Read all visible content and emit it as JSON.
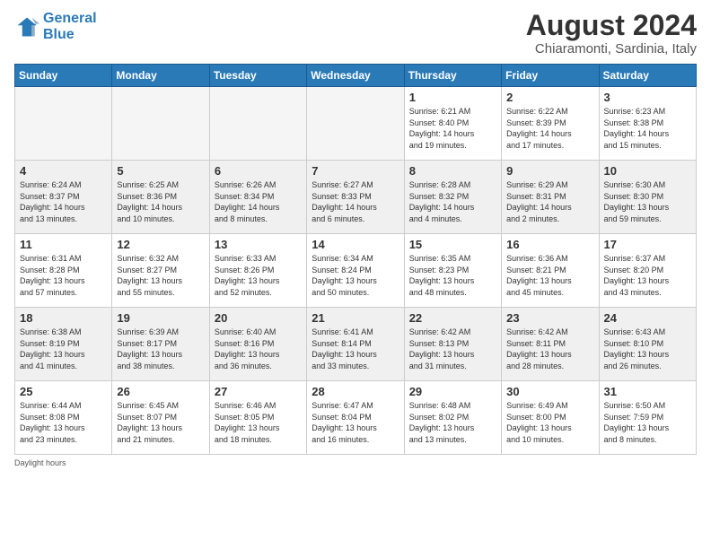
{
  "header": {
    "logo_line1": "General",
    "logo_line2": "Blue",
    "month": "August 2024",
    "location": "Chiaramonti, Sardinia, Italy"
  },
  "weekdays": [
    "Sunday",
    "Monday",
    "Tuesday",
    "Wednesday",
    "Thursday",
    "Friday",
    "Saturday"
  ],
  "weeks": [
    {
      "shaded": false,
      "days": [
        {
          "num": "",
          "info": ""
        },
        {
          "num": "",
          "info": ""
        },
        {
          "num": "",
          "info": ""
        },
        {
          "num": "",
          "info": ""
        },
        {
          "num": "1",
          "info": "Sunrise: 6:21 AM\nSunset: 8:40 PM\nDaylight: 14 hours\nand 19 minutes."
        },
        {
          "num": "2",
          "info": "Sunrise: 6:22 AM\nSunset: 8:39 PM\nDaylight: 14 hours\nand 17 minutes."
        },
        {
          "num": "3",
          "info": "Sunrise: 6:23 AM\nSunset: 8:38 PM\nDaylight: 14 hours\nand 15 minutes."
        }
      ]
    },
    {
      "shaded": true,
      "days": [
        {
          "num": "4",
          "info": "Sunrise: 6:24 AM\nSunset: 8:37 PM\nDaylight: 14 hours\nand 13 minutes."
        },
        {
          "num": "5",
          "info": "Sunrise: 6:25 AM\nSunset: 8:36 PM\nDaylight: 14 hours\nand 10 minutes."
        },
        {
          "num": "6",
          "info": "Sunrise: 6:26 AM\nSunset: 8:34 PM\nDaylight: 14 hours\nand 8 minutes."
        },
        {
          "num": "7",
          "info": "Sunrise: 6:27 AM\nSunset: 8:33 PM\nDaylight: 14 hours\nand 6 minutes."
        },
        {
          "num": "8",
          "info": "Sunrise: 6:28 AM\nSunset: 8:32 PM\nDaylight: 14 hours\nand 4 minutes."
        },
        {
          "num": "9",
          "info": "Sunrise: 6:29 AM\nSunset: 8:31 PM\nDaylight: 14 hours\nand 2 minutes."
        },
        {
          "num": "10",
          "info": "Sunrise: 6:30 AM\nSunset: 8:30 PM\nDaylight: 13 hours\nand 59 minutes."
        }
      ]
    },
    {
      "shaded": false,
      "days": [
        {
          "num": "11",
          "info": "Sunrise: 6:31 AM\nSunset: 8:28 PM\nDaylight: 13 hours\nand 57 minutes."
        },
        {
          "num": "12",
          "info": "Sunrise: 6:32 AM\nSunset: 8:27 PM\nDaylight: 13 hours\nand 55 minutes."
        },
        {
          "num": "13",
          "info": "Sunrise: 6:33 AM\nSunset: 8:26 PM\nDaylight: 13 hours\nand 52 minutes."
        },
        {
          "num": "14",
          "info": "Sunrise: 6:34 AM\nSunset: 8:24 PM\nDaylight: 13 hours\nand 50 minutes."
        },
        {
          "num": "15",
          "info": "Sunrise: 6:35 AM\nSunset: 8:23 PM\nDaylight: 13 hours\nand 48 minutes."
        },
        {
          "num": "16",
          "info": "Sunrise: 6:36 AM\nSunset: 8:21 PM\nDaylight: 13 hours\nand 45 minutes."
        },
        {
          "num": "17",
          "info": "Sunrise: 6:37 AM\nSunset: 8:20 PM\nDaylight: 13 hours\nand 43 minutes."
        }
      ]
    },
    {
      "shaded": true,
      "days": [
        {
          "num": "18",
          "info": "Sunrise: 6:38 AM\nSunset: 8:19 PM\nDaylight: 13 hours\nand 41 minutes."
        },
        {
          "num": "19",
          "info": "Sunrise: 6:39 AM\nSunset: 8:17 PM\nDaylight: 13 hours\nand 38 minutes."
        },
        {
          "num": "20",
          "info": "Sunrise: 6:40 AM\nSunset: 8:16 PM\nDaylight: 13 hours\nand 36 minutes."
        },
        {
          "num": "21",
          "info": "Sunrise: 6:41 AM\nSunset: 8:14 PM\nDaylight: 13 hours\nand 33 minutes."
        },
        {
          "num": "22",
          "info": "Sunrise: 6:42 AM\nSunset: 8:13 PM\nDaylight: 13 hours\nand 31 minutes."
        },
        {
          "num": "23",
          "info": "Sunrise: 6:42 AM\nSunset: 8:11 PM\nDaylight: 13 hours\nand 28 minutes."
        },
        {
          "num": "24",
          "info": "Sunrise: 6:43 AM\nSunset: 8:10 PM\nDaylight: 13 hours\nand 26 minutes."
        }
      ]
    },
    {
      "shaded": false,
      "days": [
        {
          "num": "25",
          "info": "Sunrise: 6:44 AM\nSunset: 8:08 PM\nDaylight: 13 hours\nand 23 minutes."
        },
        {
          "num": "26",
          "info": "Sunrise: 6:45 AM\nSunset: 8:07 PM\nDaylight: 13 hours\nand 21 minutes."
        },
        {
          "num": "27",
          "info": "Sunrise: 6:46 AM\nSunset: 8:05 PM\nDaylight: 13 hours\nand 18 minutes."
        },
        {
          "num": "28",
          "info": "Sunrise: 6:47 AM\nSunset: 8:04 PM\nDaylight: 13 hours\nand 16 minutes."
        },
        {
          "num": "29",
          "info": "Sunrise: 6:48 AM\nSunset: 8:02 PM\nDaylight: 13 hours\nand 13 minutes."
        },
        {
          "num": "30",
          "info": "Sunrise: 6:49 AM\nSunset: 8:00 PM\nDaylight: 13 hours\nand 10 minutes."
        },
        {
          "num": "31",
          "info": "Sunrise: 6:50 AM\nSunset: 7:59 PM\nDaylight: 13 hours\nand 8 minutes."
        }
      ]
    }
  ],
  "footer": {
    "daylight_label": "Daylight hours"
  }
}
